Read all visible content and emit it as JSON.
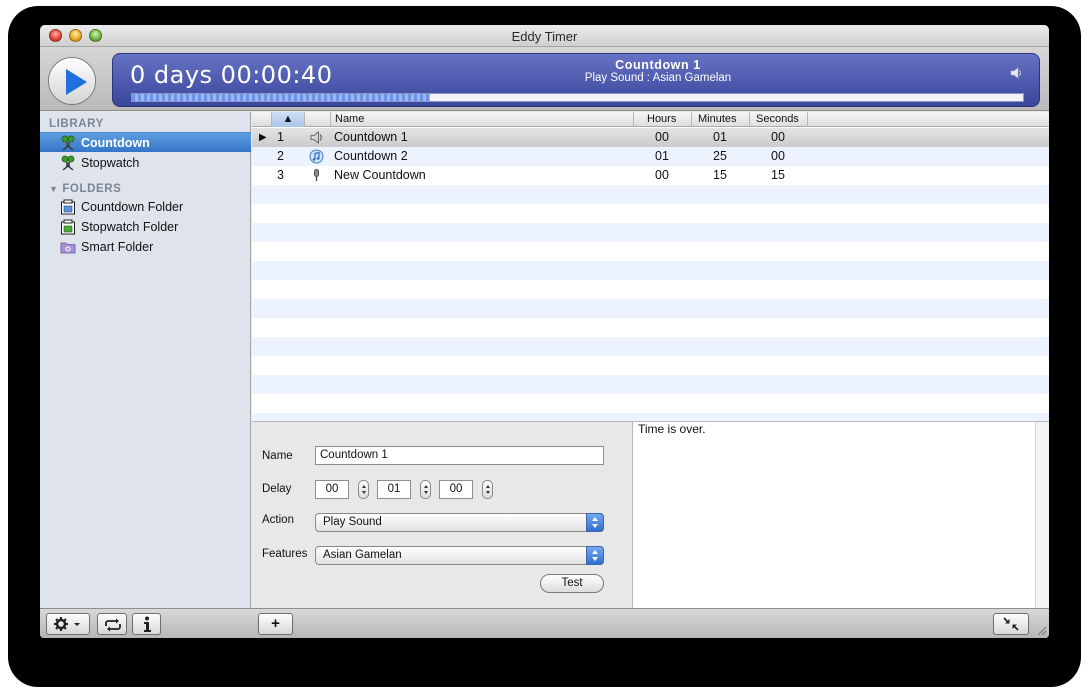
{
  "window": {
    "title": "Eddy Timer"
  },
  "display": {
    "time": "0 days 00:00:40",
    "timer_name": "Countdown 1",
    "action_summary": "Play Sound : Asian Gamelan",
    "progress": 0.335,
    "speaker_icon": "speaker-icon"
  },
  "sidebar": {
    "library_header": "LIBRARY",
    "library_items": [
      {
        "label": "Countdown",
        "icon": "countdown-timer-icon",
        "selected": true
      },
      {
        "label": "Stopwatch",
        "icon": "stopwatch-icon",
        "selected": false
      }
    ],
    "folders_header": "FOLDERS",
    "folder_items": [
      {
        "label": "Countdown Folder",
        "icon": "countdown-folder-icon"
      },
      {
        "label": "Stopwatch Folder",
        "icon": "stopwatch-folder-icon"
      },
      {
        "label": "Smart Folder",
        "icon": "smart-folder-icon"
      }
    ]
  },
  "table": {
    "columns": {
      "sort": "▲",
      "name": "Name",
      "hours": "Hours",
      "minutes": "Minutes",
      "seconds": "Seconds"
    },
    "rows": [
      {
        "index": "1",
        "icon": "speaker-icon",
        "name": "Countdown 1",
        "hours": "00",
        "minutes": "01",
        "seconds": "00",
        "selected": true,
        "arrow": "▶"
      },
      {
        "index": "2",
        "icon": "itunes-icon",
        "name": "Countdown 2",
        "hours": "01",
        "minutes": "25",
        "seconds": "00",
        "selected": false
      },
      {
        "index": "3",
        "icon": "microphone-icon",
        "name": "New Countdown",
        "hours": "00",
        "minutes": "15",
        "seconds": "15",
        "selected": false
      }
    ]
  },
  "form": {
    "name_label": "Name",
    "name_value": "Countdown 1",
    "delay_label": "Delay",
    "delay_hours": "00",
    "delay_minutes": "01",
    "delay_seconds": "00",
    "action_label": "Action",
    "action_value": "Play Sound",
    "features_label": "Features",
    "features_value": "Asian Gamelan",
    "test_label": "Test"
  },
  "message": {
    "text": "Time is over."
  },
  "bottombar": {
    "gear_icon": "gear-icon",
    "repeat_icon": "repeat-icon",
    "info_icon": "info-icon",
    "add_label": "+",
    "collapse_icon": "collapse-icon"
  },
  "colors": {
    "display_bg": "#4b57ac",
    "selection": "#3f80d2",
    "play_blue": "#1f6fe0"
  }
}
